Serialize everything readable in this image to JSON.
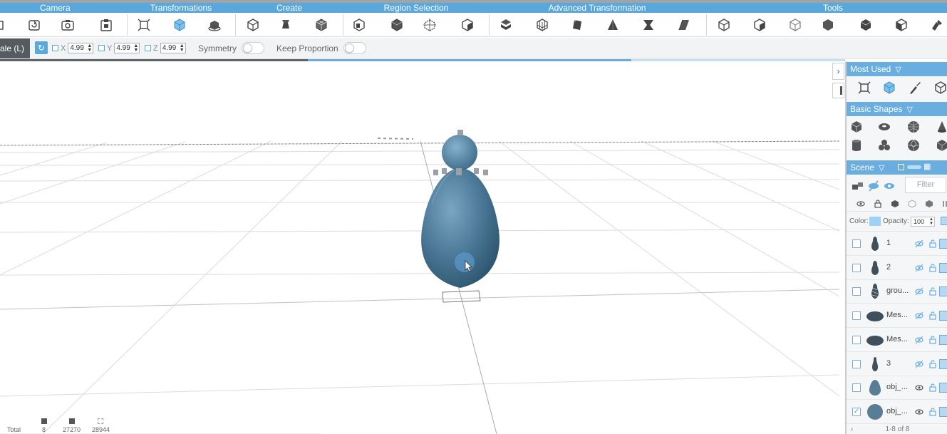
{
  "ribbon": {
    "categories": [
      "Camera",
      "Transformations",
      "Create",
      "Region Selection",
      "Advanced Transformation",
      "Tools"
    ],
    "accent_color": "#5aa7dc",
    "tools": [
      "camera-icon",
      "rotate-view-icon",
      "snapshot-icon",
      "paste-icon",
      "move-icon",
      "scale-cube-icon",
      "rotate-object-icon",
      "create-box-icon",
      "extrude-icon",
      "subdivide-icon",
      "region-box-icon",
      "region-plane-icon",
      "region-select-icon",
      "adv-bend-icon",
      "adv-lattice-icon",
      "adv-twist-icon",
      "adv-taper-icon",
      "adv-pinch-icon",
      "adv-skew-icon",
      "tool-box-icon",
      "tool-cube-icon",
      "tool-mesh-icon",
      "tool-dodeca-icon",
      "tool-poly-icon",
      "tool-cube2-icon",
      "tool-brush-icon"
    ]
  },
  "options": {
    "mode_label": "ale (L)",
    "x_label": "X",
    "x_value": "4.99",
    "y_label": "Y",
    "y_value": "4.99",
    "z_label": "Z",
    "z_value": "4.99",
    "symmetry_label": "Symmetry",
    "keep_proportion_label": "Keep Proportion"
  },
  "viewport": {
    "stats_total_label": "Total",
    "stats_values": [
      "8",
      "27270",
      "28944"
    ]
  },
  "panel": {
    "most_used": "Most Used",
    "basic_shapes": "Basic Shapes",
    "scene": "Scene",
    "filter_placeholder": "Filter",
    "color_label": "Color:",
    "opacity_label": "Opacity:",
    "opacity_value": "100",
    "object_color": "#9ed2f4",
    "rows": [
      {
        "name": "1",
        "checked": false
      },
      {
        "name": "2",
        "checked": false
      },
      {
        "name": "grou...",
        "checked": false
      },
      {
        "name": "Mes...",
        "checked": false
      },
      {
        "name": "Mes...",
        "checked": false
      },
      {
        "name": "3",
        "checked": false
      },
      {
        "name": "obj_...",
        "checked": false
      },
      {
        "name": "obj_...",
        "checked": true
      }
    ],
    "pager": "1-8 of 8"
  }
}
